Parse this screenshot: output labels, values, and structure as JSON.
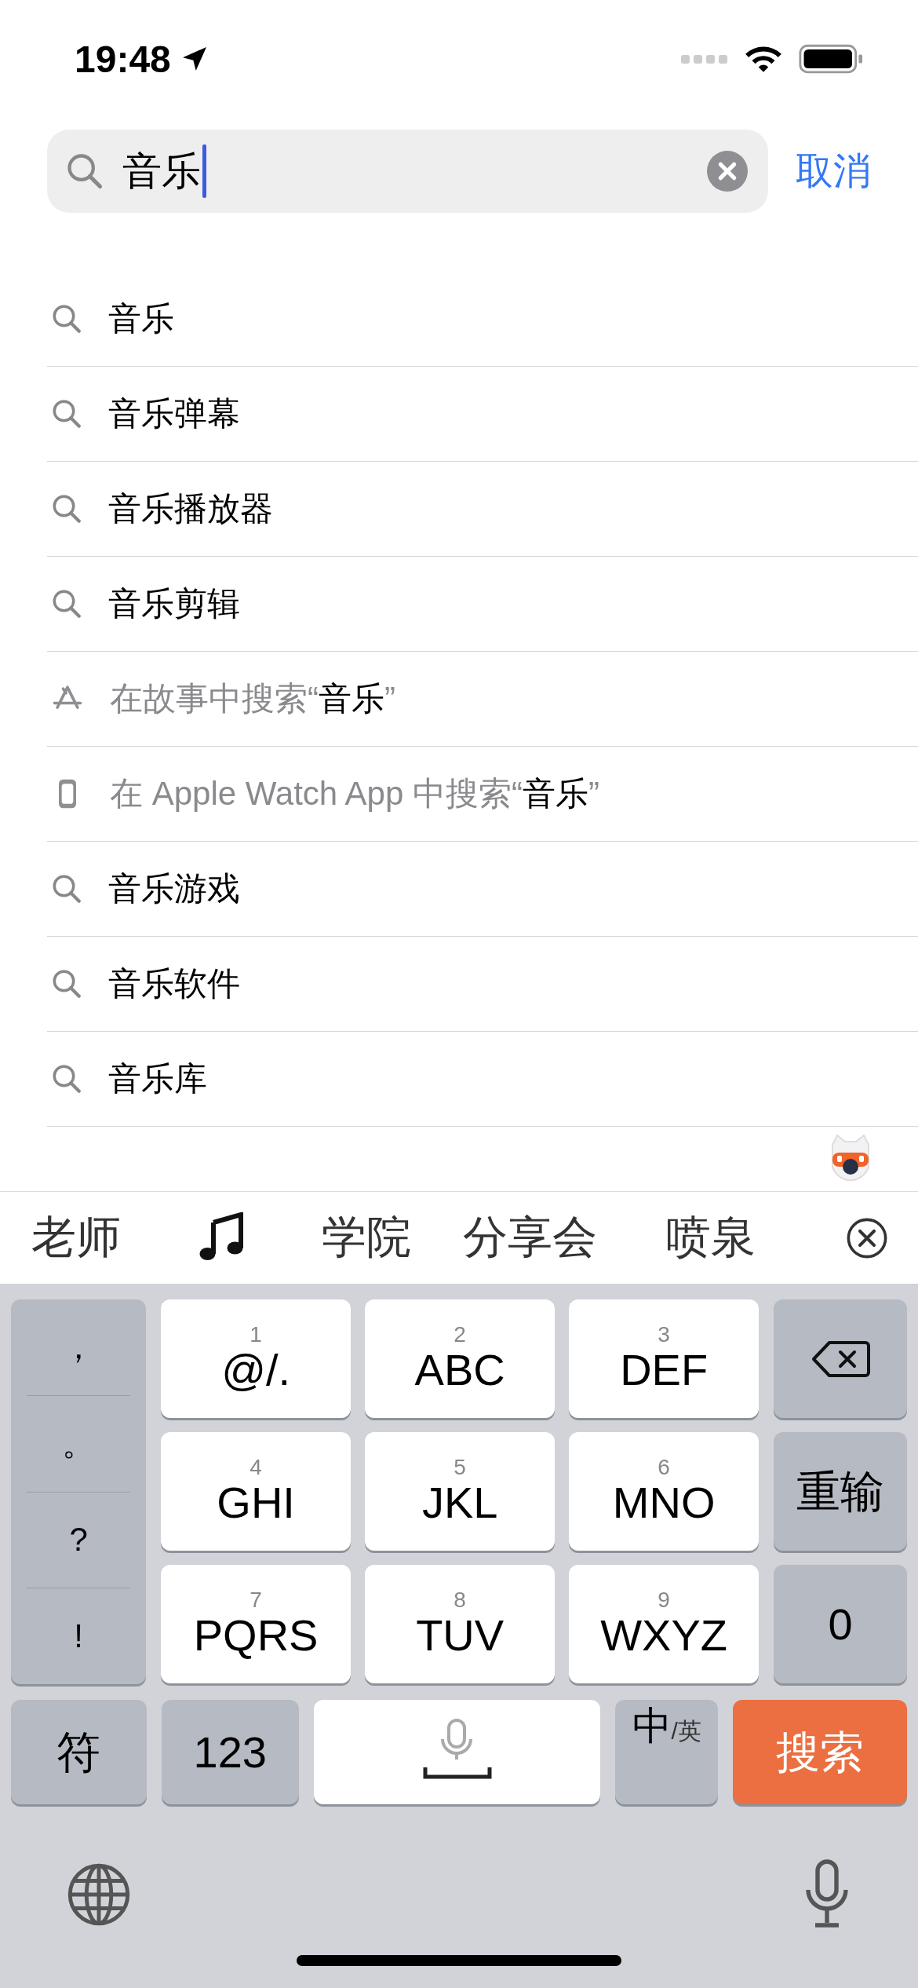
{
  "status_bar": {
    "time": "19:48"
  },
  "search": {
    "value": "音乐",
    "cancel": "取消"
  },
  "suggestions": [
    {
      "kind": "search",
      "text": "音乐"
    },
    {
      "kind": "search",
      "text": "音乐弹幕"
    },
    {
      "kind": "search",
      "text": "音乐播放器"
    },
    {
      "kind": "search",
      "text": "音乐剪辑"
    },
    {
      "kind": "app_store",
      "prefix": "在故事中搜索“",
      "query": "音乐",
      "suffix": "”"
    },
    {
      "kind": "watch",
      "prefix": "在 Apple Watch App 中搜索“",
      "query": "音乐",
      "suffix": "”"
    },
    {
      "kind": "search",
      "text": "音乐游戏"
    },
    {
      "kind": "search",
      "text": "音乐软件"
    },
    {
      "kind": "search",
      "text": "音乐库"
    }
  ],
  "candidates": [
    {
      "kind": "text",
      "text": "老师"
    },
    {
      "kind": "music_note"
    },
    {
      "kind": "text",
      "text": "学院"
    },
    {
      "kind": "text",
      "text": "分享会"
    },
    {
      "kind": "text",
      "text": "喷泉"
    }
  ],
  "keyboard": {
    "punctuation": [
      "，",
      "。",
      "?",
      "!"
    ],
    "keys": [
      {
        "number": "1",
        "letters": "@/."
      },
      {
        "number": "2",
        "letters": "ABC"
      },
      {
        "number": "3",
        "letters": "DEF"
      },
      {
        "number": "4",
        "letters": "GHI"
      },
      {
        "number": "5",
        "letters": "JKL"
      },
      {
        "number": "6",
        "letters": "MNO"
      },
      {
        "number": "7",
        "letters": "PQRS"
      },
      {
        "number": "8",
        "letters": "TUV"
      },
      {
        "number": "9",
        "letters": "WXYZ"
      }
    ],
    "side_keys": [
      {
        "kind": "delete"
      },
      {
        "kind": "text",
        "text": "重输"
      },
      {
        "kind": "text",
        "text": "0"
      }
    ],
    "bottom_row": [
      {
        "kind": "gray",
        "text": "符"
      },
      {
        "kind": "gray",
        "text": "123"
      },
      {
        "kind": "space"
      },
      {
        "kind": "lang",
        "text": "中",
        "sub": "/英"
      },
      {
        "kind": "action",
        "text": "搜索"
      }
    ]
  }
}
